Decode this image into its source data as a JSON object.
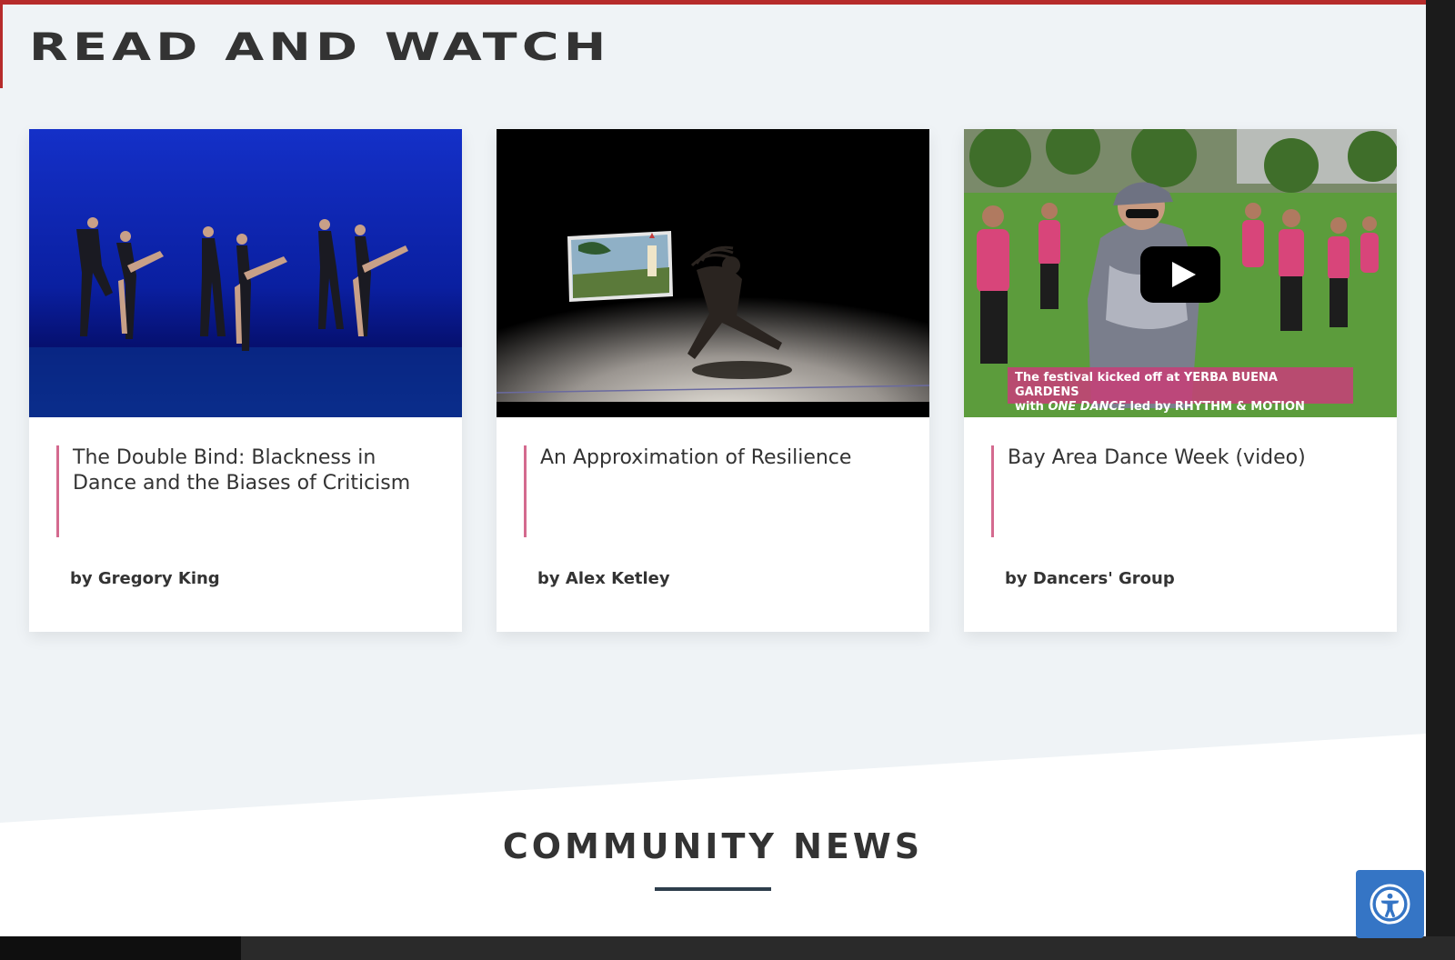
{
  "read_and_watch": {
    "title": "Read and Watch",
    "cards": [
      {
        "title": "The Double Bind: Blackness in Dance and the Biases of Criticism",
        "author": "by Gregory King"
      },
      {
        "title": "An Approximation of Resilience",
        "author": "by Alex Ketley"
      },
      {
        "title": "Bay Area Dance Week (video)",
        "author": "by Dancers' Group",
        "caption_line1": "The festival kicked off at YERBA BUENA GARDENS",
        "caption_line2_pre": "with ",
        "caption_line2_em": "ONE DANCE",
        "caption_line2_post": " led by RHYTHM & MOTION"
      }
    ]
  },
  "community_news": {
    "title": "Community News"
  },
  "accessibility": {
    "icon": "accessibility-icon"
  },
  "colors": {
    "top_bar": "#b62b2b",
    "accent_bar": "#d46a8f",
    "a11y": "#3575c5",
    "underline": "#2e3e4c"
  }
}
